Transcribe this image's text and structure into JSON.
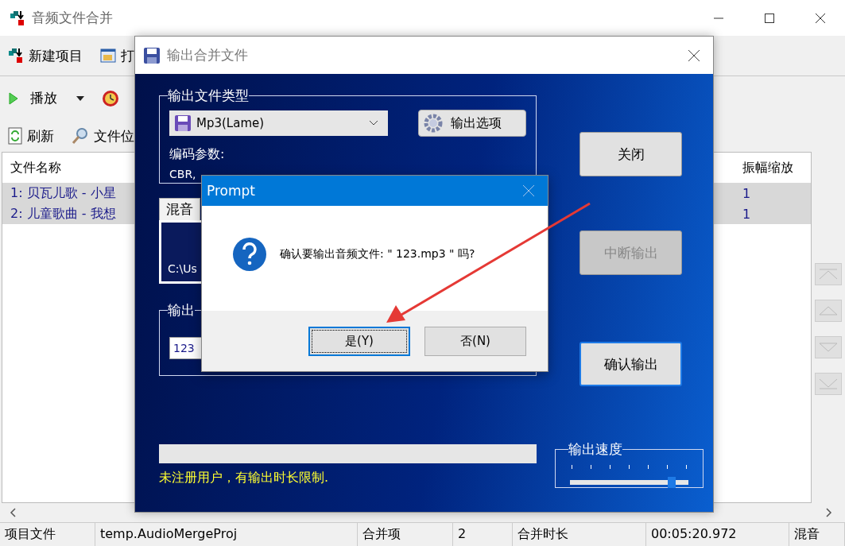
{
  "window": {
    "title": "音频文件合并"
  },
  "toolbar_rows": [
    [
      {
        "kind": "new",
        "label": "新建项目",
        "dropdown": false
      },
      {
        "kind": "open",
        "label": "打",
        "dropdown": false
      }
    ],
    [
      {
        "kind": "play",
        "label": "播放",
        "dropdown": true
      },
      {
        "kind": "clock",
        "dropdown": false
      }
    ],
    [
      {
        "kind": "refresh",
        "label": "刷新",
        "dropdown": false
      },
      {
        "kind": "search",
        "label": "文件位",
        "dropdown": false
      }
    ]
  ],
  "file_list": {
    "columns": [
      "文件名称",
      "振幅缩放"
    ],
    "rows": [
      {
        "name": "1: 贝瓦儿歌 - 小星",
        "amplitude": "1",
        "selected": true
      },
      {
        "name": "2: 儿童歌曲 - 我想",
        "amplitude": "1",
        "selected": true
      }
    ]
  },
  "side_buttons": [
    {
      "kind": "top",
      "disabled": true
    },
    {
      "kind": "up",
      "disabled": true
    },
    {
      "kind": "down",
      "disabled": true
    },
    {
      "kind": "bottom",
      "disabled": true
    }
  ],
  "status_bar": [
    "项目文件",
    "temp.AudioMergeProj",
    "合并项",
    "2",
    "合并时长",
    "00:05:20.972",
    "混音"
  ],
  "dialog": {
    "title": "输出合并文件",
    "file_type_group": {
      "label": "输出文件类型",
      "format": "Mp3(Lame)",
      "options_button": "输出选项",
      "params_label": "编码参数:",
      "params": "CBR,"
    },
    "mix_tab": {
      "label": "混音",
      "path": "C:\\Us"
    },
    "output_group": {
      "label": "输出",
      "filename": "123"
    },
    "progress": {
      "level": 0
    },
    "notice": "未注册用户，有输出时长限制.",
    "buttons": [
      {
        "label": "关闭",
        "disabled": false,
        "focused": false
      },
      {
        "label": "中断输出",
        "disabled": true,
        "focused": false
      },
      {
        "label": "确认输出",
        "disabled": false,
        "focused": true
      }
    ],
    "speed": {
      "label": "输出速度",
      "level": 0.86
    }
  },
  "prompt": {
    "title": "Prompt",
    "message": "确认要输出音频文件: \" 123.mp3 \" 吗?",
    "buttons": [
      {
        "label": "是(Y)",
        "focused": true
      },
      {
        "label": "否(N)",
        "focused": false
      }
    ]
  }
}
